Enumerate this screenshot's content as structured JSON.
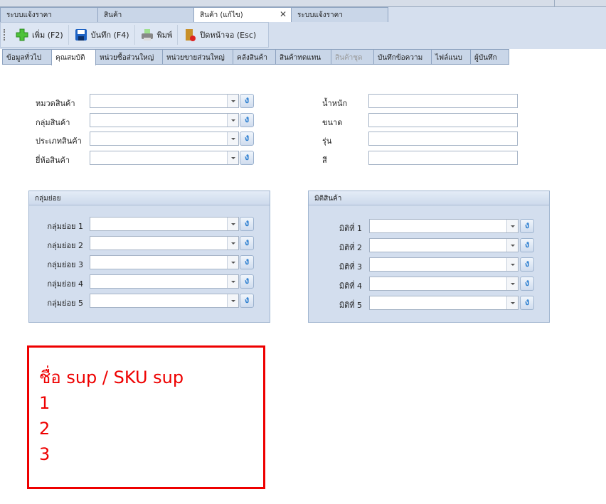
{
  "doc_tabs": [
    "ระบบแจ้งราคา",
    "สินค้า",
    "สินค้า (แก้ไข)",
    "ระบบแจ้งราคา"
  ],
  "toolbar": {
    "add": "เพิ่ม (F2)",
    "save": "บันทึก (F4)",
    "print": "พิมพ์",
    "close": "ปิดหน้าจอ (Esc)"
  },
  "sub_tabs": [
    "ข้อมูลทั่วไป",
    "คุณสมบัติ",
    "หน่วยซื้อส่วนใหญ่",
    "หน่วยขายส่วนใหญ่",
    "คลังสินค้า",
    "สินค้าทดแทน",
    "สินค้าชุด",
    "บันทึกข้อความ",
    "ไฟล์แนบ",
    "ผู้บันทึก"
  ],
  "left_fields": [
    "หมวดสินค้า",
    "กลุ่มสินค้า",
    "ประเภทสินค้า",
    "ยี่ห้อสินค้า"
  ],
  "right_fields": [
    "น้ำหนัก",
    "ขนาด",
    "รุ่น",
    "สี"
  ],
  "subgroup": {
    "title": "กลุ่มย่อย",
    "items": [
      "กลุ่มย่อย 1",
      "กลุ่มย่อย 2",
      "กลุ่มย่อย 3",
      "กลุ่มย่อย 4",
      "กลุ่มย่อย 5"
    ]
  },
  "dimension": {
    "title": "มิติสินค้า",
    "items": [
      "มิติที่ 1",
      "มิติที่ 2",
      "มิติที่ 3",
      "มิติที่ 4",
      "มิติที่ 5"
    ]
  },
  "note": {
    "lines": [
      "ชื่อ sup / SKU sup",
      "1",
      "2",
      "3"
    ]
  },
  "refresh_icon": "ง"
}
